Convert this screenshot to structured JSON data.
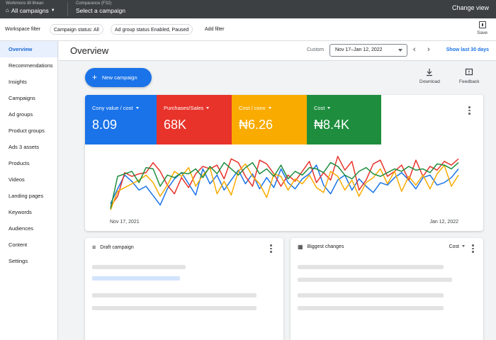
{
  "topbar": {
    "account_label": "Workmons till lihean",
    "account_value": "All campaigns",
    "campaign_label": "Comparance (F32)",
    "campaign_value": "Select a campaign",
    "change_view": "Change view"
  },
  "filters": {
    "workspace": "Workspace filter",
    "campaign_status": "Campaign status: All",
    "ad_group_status": "Ad group status Enabled, Paused",
    "add_filter": "Add filter",
    "save": "Save"
  },
  "sidebar": {
    "items": [
      {
        "label": "Overview",
        "active": true
      },
      {
        "label": "Recommendations"
      },
      {
        "label": "Insights"
      },
      {
        "label": "Campaigns"
      },
      {
        "label": "Ad groups"
      },
      {
        "label": "Product groups"
      },
      {
        "label": "Ads 3 assets"
      },
      {
        "label": "Products"
      },
      {
        "label": "Videos"
      },
      {
        "label": "Landing pages"
      },
      {
        "label": "Keywords"
      },
      {
        "label": "Audiences"
      },
      {
        "label": "Content"
      },
      {
        "label": "Settings"
      }
    ]
  },
  "header": {
    "title": "Overview",
    "custom": "Custom",
    "date_range": "Nov 17–Jan 12, 2022",
    "prev": "‹",
    "next": "›",
    "show_last": "Show last 30 days"
  },
  "actions": {
    "new_campaign": "New campaign",
    "download": "Download",
    "feedback": "Feedback"
  },
  "metrics": [
    {
      "name": "Cony value / cost",
      "value": "8.09",
      "color": "#1a73e8"
    },
    {
      "name": "Purchases/Sales",
      "value": "68K",
      "color": "#e8332a"
    },
    {
      "name": "Cost / conv",
      "value": "₦6.26",
      "color": "#f9ab00"
    },
    {
      "name": "Cost",
      "value": "₦8.4K",
      "color": "#1e8e3e"
    }
  ],
  "chart_data": {
    "type": "line",
    "x_start_label": "Nov 17, 2021",
    "x_end_label": "Jan 12, 2022",
    "grid": false,
    "legend": "none",
    "series": [
      {
        "color": "#1a73e8",
        "values": [
          14,
          38,
          60,
          50,
          36,
          42,
          27,
          12,
          38,
          54,
          64,
          46,
          28,
          70,
          46,
          60,
          36,
          52,
          68,
          46,
          62,
          38,
          56,
          40,
          70,
          48,
          38,
          54,
          62,
          76,
          44,
          30,
          52,
          60,
          36,
          54,
          42,
          32,
          48,
          44,
          56,
          64,
          52,
          38,
          56,
          60,
          44,
          48,
          56,
          70
        ]
      },
      {
        "color": "#e8332a",
        "values": [
          10,
          26,
          64,
          58,
          62,
          64,
          80,
          66,
          44,
          30,
          56,
          40,
          62,
          74,
          70,
          76,
          54,
          86,
          80,
          58,
          42,
          84,
          78,
          62,
          42,
          60,
          50,
          66,
          82,
          48,
          64,
          52,
          90,
          68,
          82,
          36,
          52,
          78,
          84,
          58,
          66,
          76,
          52,
          84,
          58,
          74,
          68,
          82,
          76,
          86
        ]
      },
      {
        "color": "#f9ab00",
        "values": [
          4,
          34,
          40,
          46,
          52,
          60,
          48,
          26,
          44,
          66,
          58,
          72,
          42,
          60,
          72,
          30,
          50,
          28,
          66,
          78,
          58,
          46,
          24,
          62,
          58,
          36,
          54,
          46,
          60,
          40,
          32,
          66,
          58,
          36,
          52,
          26,
          48,
          56,
          70,
          46,
          66,
          34,
          58,
          44,
          60,
          38,
          62,
          76,
          42,
          60
        ]
      },
      {
        "color": "#1e8e3e",
        "values": [
          6,
          58,
          62,
          66,
          48,
          72,
          70,
          42,
          60,
          56,
          64,
          62,
          70,
          56,
          74,
          62,
          80,
          70,
          60,
          72,
          80,
          62,
          70,
          58,
          76,
          54,
          66,
          60,
          72,
          70,
          64,
          80,
          74,
          60,
          54,
          66,
          72,
          62,
          58,
          64,
          70,
          66,
          74,
          68,
          70,
          64,
          78,
          76,
          70,
          80
        ]
      }
    ]
  },
  "cards": {
    "draft": "Draft campaign",
    "biggest": "Biggest changes",
    "sort": "Cost"
  }
}
